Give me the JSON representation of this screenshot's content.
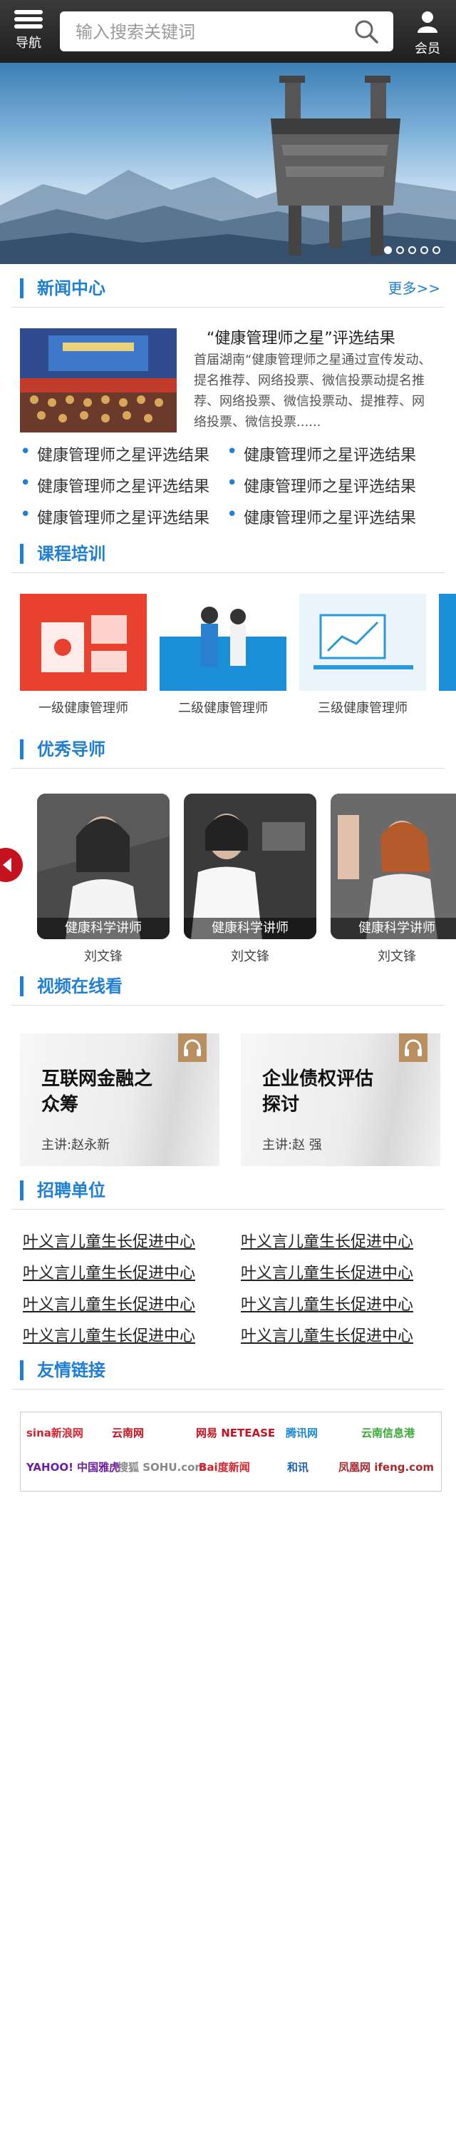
{
  "header": {
    "nav_label": "导航",
    "search_placeholder": "输入搜索关键词",
    "member_label": "会员"
  },
  "banner": {
    "slide_count": 5,
    "active_slide": 1
  },
  "news": {
    "title": "新闻中心",
    "more": "更多>>",
    "featured_title": "“健康管理师之星”评选结果",
    "featured_summary": "首届湖南“健康管理师之星通过宣传发动、提名推荐、网络投票、微信投票动提名推荐、网络投票、微信投票动、提推荐、网络投票、微信投票......",
    "items": [
      "健康管理师之星评选结果",
      "健康管理师之星评选结果",
      "健康管理师之星评选结果",
      "健康管理师之星评选结果",
      "健康管理师之星评选结果",
      "健康管理师之星评选结果"
    ]
  },
  "courses": {
    "title": "课程培训",
    "items": [
      {
        "label": "一级健康管理师"
      },
      {
        "label": "二级健康管理师"
      },
      {
        "label": "三级健康管理师"
      }
    ]
  },
  "teachers": {
    "title": "优秀导师",
    "items": [
      {
        "caption": "健康科学讲师",
        "name": "刘文锋"
      },
      {
        "caption": "健康科学讲师",
        "name": "刘文锋"
      },
      {
        "caption": "健康科学讲师",
        "name": "刘文锋"
      }
    ]
  },
  "videos": {
    "title": "视频在线看",
    "items": [
      {
        "title_line1": "互联网金融之",
        "title_line2": "众筹",
        "speaker": "主讲:赵永新"
      },
      {
        "title_line1": "企业债权评估",
        "title_line2": "探讨",
        "speaker": "主讲:赵  强"
      }
    ]
  },
  "recruit": {
    "title": "招聘单位",
    "items": [
      "叶义言儿童生长促进中心",
      "叶义言儿童生长促进中心",
      "叶义言儿童生长促进中心",
      "叶义言儿童生长促进中心",
      "叶义言儿童生长促进中心",
      "叶义言儿童生长促进中心",
      "叶义言儿童生长促进中心",
      "叶义言儿童生长促进中心"
    ]
  },
  "links": {
    "title": "友情链接",
    "logos": [
      {
        "text": "sina新浪网",
        "color": "#d5232d"
      },
      {
        "text": "云南网",
        "color": "#c4121e"
      },
      {
        "text": "网易 NETEASE",
        "color": "#c4121e"
      },
      {
        "text": "腾讯网",
        "color": "#1a8ad8"
      },
      {
        "text": "云南信息港",
        "color": "#3aa935"
      },
      {
        "text": "YAHOO! 中国雅虎",
        "color": "#6b1f9e"
      },
      {
        "text": "搜狐 SOHU.com",
        "color": "#888888"
      },
      {
        "text": "Bai度新闻",
        "color": "#d5232d"
      },
      {
        "text": "和讯",
        "color": "#1d63b4"
      },
      {
        "text": "凤凰网 ifeng.com",
        "color": "#a8292e"
      }
    ]
  },
  "colors": {
    "accent": "#1f7fd4",
    "header_bg": "#2b2b2b"
  }
}
